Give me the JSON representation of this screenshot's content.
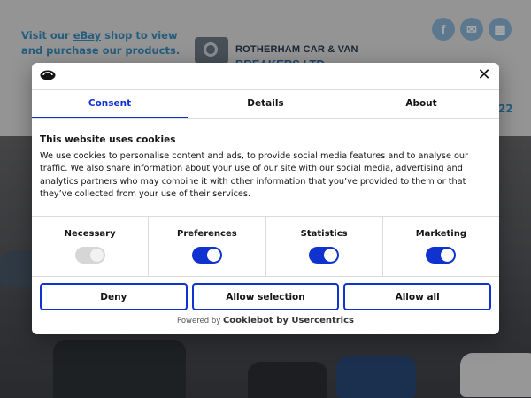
{
  "site": {
    "ebay_prefix": "Visit our ",
    "ebay_link": "eBay",
    "ebay_suffix": " shop to view and purchase our products.",
    "logo_line1": "ROTHERHAM CAR & VAN",
    "logo_line2": "BREAKERS LTD",
    "social": [
      {
        "icon": "facebook-icon",
        "glyph": "f"
      },
      {
        "icon": "email-icon",
        "glyph": "✉"
      },
      {
        "icon": "shop-icon",
        "glyph": "▦"
      }
    ],
    "phone_fragment": "22",
    "colors": {
      "link": "#3a8fc2",
      "brand_dark": "#2a3c52",
      "brand_blue": "#2a6fb1"
    }
  },
  "dialog": {
    "tabs": [
      {
        "label": "Consent",
        "active": true
      },
      {
        "label": "Details",
        "active": false
      },
      {
        "label": "About",
        "active": false
      }
    ],
    "heading": "This website uses cookies",
    "body": "We use cookies to personalise content and ads, to provide social media features and to analyse our traffic. We also share information about your use of our site with our social media, advertising and analytics partners who may combine it with other information that you’ve provided to them or that they’ve collected from your use of their services.",
    "toggles": [
      {
        "label": "Necessary",
        "checked": true,
        "disabled": true
      },
      {
        "label": "Preferences",
        "checked": true,
        "disabled": false
      },
      {
        "label": "Statistics",
        "checked": true,
        "disabled": false
      },
      {
        "label": "Marketing",
        "checked": true,
        "disabled": false
      }
    ],
    "buttons": {
      "deny": "Deny",
      "allow_selection": "Allow selection",
      "allow_all": "Allow all"
    },
    "powered_prefix": "Powered by",
    "powered_brand": "Cookiebot by Usercentrics",
    "close_glyph": "✕",
    "colors": {
      "accent": "#1032cf",
      "text": "#141414",
      "toggle_disabled": "#d6d6d6"
    }
  }
}
